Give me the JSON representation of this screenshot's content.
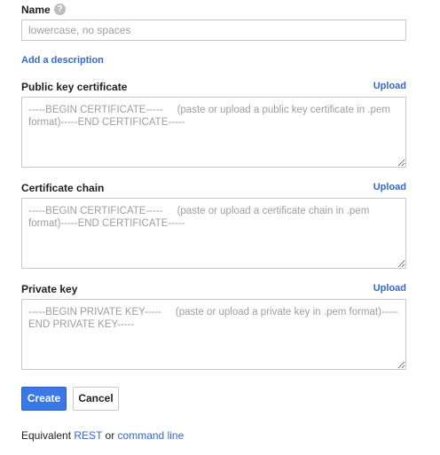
{
  "name": {
    "label": "Name",
    "help_glyph": "?",
    "placeholder": "lowercase, no spaces",
    "value": ""
  },
  "add_description": "Add a description",
  "public_key_certificate": {
    "label": "Public key certificate",
    "upload": "Upload",
    "placeholder": "-----BEGIN CERTIFICATE-----     (paste or upload a public key certificate in .pem format)-----END CERTIFICATE-----"
  },
  "certificate_chain": {
    "label": "Certificate chain",
    "upload": "Upload",
    "placeholder": "-----BEGIN CERTIFICATE-----     (paste or upload a certificate chain in .pem format)-----END CERTIFICATE-----"
  },
  "private_key": {
    "label": "Private key",
    "upload": "Upload",
    "placeholder": "-----BEGIN PRIVATE KEY-----     (paste or upload a private key in .pem format)-----END PRIVATE KEY-----"
  },
  "actions": {
    "create": "Create",
    "cancel": "Cancel"
  },
  "footer": {
    "prefix": "Equivalent",
    "rest": "REST",
    "or": "or",
    "command_line": "command line"
  },
  "colors": {
    "link": "#3367d6",
    "primary_button": "#3b78e7",
    "border": "#c8c8c8",
    "placeholder": "#9e9e9e"
  },
  "icons": {
    "help": "help-icon",
    "resize": "resize-handle-icon"
  }
}
